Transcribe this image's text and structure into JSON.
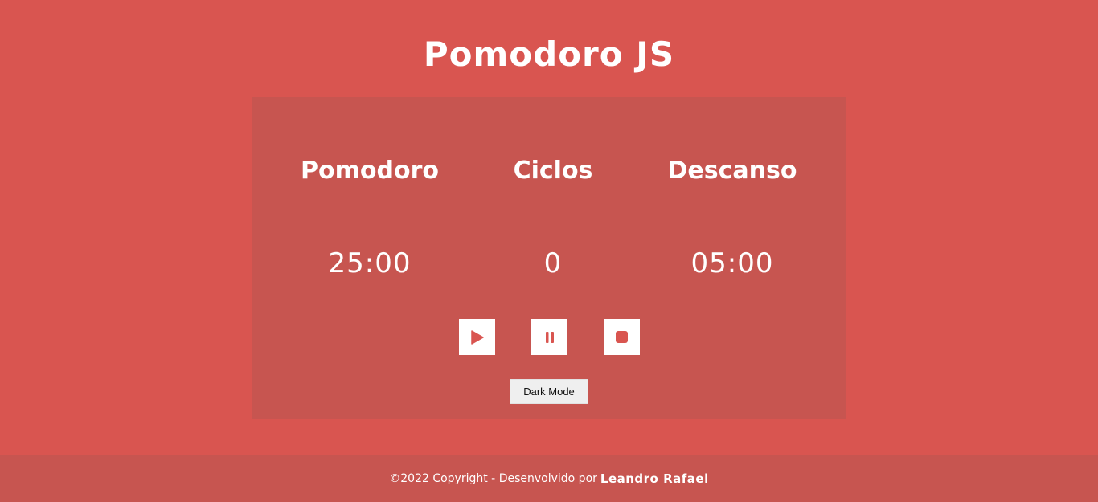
{
  "header": {
    "title": "Pomodoro JS"
  },
  "timer": {
    "pomodoro": {
      "label": "Pomodoro",
      "value": "25:00"
    },
    "cycles": {
      "label": "Ciclos",
      "value": "0"
    },
    "rest": {
      "label": "Descanso",
      "value": "05:00"
    }
  },
  "controls": {
    "play": {
      "icon": "play-icon"
    },
    "pause": {
      "icon": "pause-icon"
    },
    "stop": {
      "icon": "stop-icon"
    },
    "dark_mode_label": "Dark Mode"
  },
  "footer": {
    "text": "©2022 Copyright - Desenvolvido por",
    "author": "Leandro Rafael"
  },
  "colors": {
    "background": "#d95550",
    "panel": "#c75550",
    "icon": "#d95550",
    "text": "#ffffff"
  }
}
